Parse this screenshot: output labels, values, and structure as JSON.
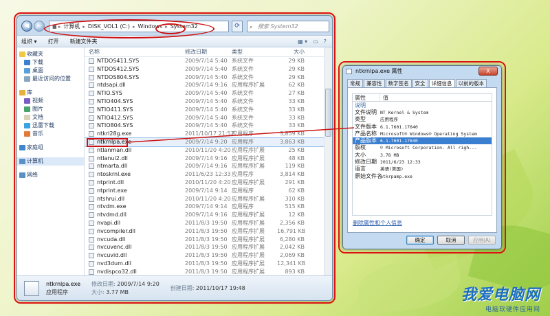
{
  "explorer": {
    "address": [
      "计算机",
      "DISK_VOL1 (C:)",
      "Windows",
      "System32"
    ],
    "search_placeholder": "搜索 System32",
    "toolbar": {
      "organize": "组织 ▾",
      "open": "打开",
      "new_folder": "新建文件夹"
    },
    "sidebar": [
      {
        "label": "收藏夹",
        "head": true,
        "icon": "star-icon"
      },
      {
        "label": "下载",
        "head": false,
        "icon": "download-icon"
      },
      {
        "label": "桌面",
        "head": false,
        "icon": "desktop-icon"
      },
      {
        "label": "最近访问的位置",
        "head": false,
        "icon": "recent-icon"
      },
      {
        "label": "库",
        "head": true,
        "icon": "library-icon"
      },
      {
        "label": "视频",
        "head": false,
        "icon": "video-icon"
      },
      {
        "label": "图片",
        "head": false,
        "icon": "picture-icon"
      },
      {
        "label": "文档",
        "head": false,
        "icon": "document-icon"
      },
      {
        "label": "迅雷下载",
        "head": false,
        "icon": "thunder-icon"
      },
      {
        "label": "音乐",
        "head": false,
        "icon": "music-icon"
      },
      {
        "label": "家庭组",
        "head": true,
        "icon": "homegroup-icon"
      },
      {
        "label": "计算机",
        "head": true,
        "icon": "computer-icon",
        "selected": true
      },
      {
        "label": "网络",
        "head": true,
        "icon": "network-icon"
      }
    ],
    "columns": {
      "name": "名称",
      "date": "修改日期",
      "type": "类型",
      "size": "大小"
    },
    "files": [
      {
        "name": "NTDOS411.SYS",
        "date": "2009/7/14 5:40",
        "type": "系统文件",
        "size": "29 KB"
      },
      {
        "name": "NTDOS412.SYS",
        "date": "2009/7/14 5:40",
        "type": "系统文件",
        "size": "29 KB"
      },
      {
        "name": "NTDOS804.SYS",
        "date": "2009/7/14 5:40",
        "type": "系统文件",
        "size": "29 KB"
      },
      {
        "name": "ntdsapi.dll",
        "date": "2009/7/14 9:16",
        "type": "应用程序扩展",
        "size": "62 KB"
      },
      {
        "name": "NTIO.SYS",
        "date": "2009/7/14 5:40",
        "type": "系统文件",
        "size": "27 KB"
      },
      {
        "name": "NTIO404.SYS",
        "date": "2009/7/14 5:40",
        "type": "系统文件",
        "size": "33 KB"
      },
      {
        "name": "NTIO411.SYS",
        "date": "2009/7/14 5:40",
        "type": "系统文件",
        "size": "33 KB"
      },
      {
        "name": "NTIO412.SYS",
        "date": "2009/7/14 5:40",
        "type": "系统文件",
        "size": "33 KB"
      },
      {
        "name": "NTIO804.SYS",
        "date": "2009/7/14 5:40",
        "type": "系统文件",
        "size": "33 KB"
      },
      {
        "name": "ntkrl28g.exe",
        "date": "2011/10/17 21:52",
        "type": "应用程序",
        "size": "3,859 KB"
      },
      {
        "name": "ntkrnlpa.exe",
        "date": "2009/7/14 9:20",
        "type": "应用程序",
        "size": "3,863 KB",
        "highlight": true
      },
      {
        "name": "ntlanman.dll",
        "date": "2010/11/20 4:20",
        "type": "应用程序扩展",
        "size": "25 KB"
      },
      {
        "name": "ntlanui2.dll",
        "date": "2009/7/14 9:16",
        "type": "应用程序扩展",
        "size": "48 KB"
      },
      {
        "name": "ntmarta.dll",
        "date": "2009/7/14 9:16",
        "type": "应用程序扩展",
        "size": "119 KB"
      },
      {
        "name": "ntoskrnl.exe",
        "date": "2011/6/23 12:33",
        "type": "应用程序",
        "size": "3,814 KB"
      },
      {
        "name": "ntprint.dll",
        "date": "2010/11/20 4:20",
        "type": "应用程序扩展",
        "size": "291 KB"
      },
      {
        "name": "ntprint.exe",
        "date": "2009/7/14 9:14",
        "type": "应用程序",
        "size": "62 KB"
      },
      {
        "name": "ntshrui.dll",
        "date": "2010/11/20 4:20",
        "type": "应用程序扩展",
        "size": "310 KB"
      },
      {
        "name": "ntvdm.exe",
        "date": "2009/7/14 9:14",
        "type": "应用程序",
        "size": "515 KB"
      },
      {
        "name": "ntvdmd.dll",
        "date": "2009/7/14 9:16",
        "type": "应用程序扩展",
        "size": "12 KB"
      },
      {
        "name": "nvapi.dll",
        "date": "2011/8/3 19:50",
        "type": "应用程序扩展",
        "size": "2,356 KB"
      },
      {
        "name": "nvcompiler.dll",
        "date": "2011/8/3 19:50",
        "type": "应用程序扩展",
        "size": "16,791 KB"
      },
      {
        "name": "nvcuda.dll",
        "date": "2011/8/3 19:50",
        "type": "应用程序扩展",
        "size": "6,280 KB"
      },
      {
        "name": "nvcuvenc.dll",
        "date": "2011/8/3 19:50",
        "type": "应用程序扩展",
        "size": "2,042 KB"
      },
      {
        "name": "nvcuvid.dll",
        "date": "2011/8/3 19:50",
        "type": "应用程序扩展",
        "size": "2,069 KB"
      },
      {
        "name": "nvd3dum.dll",
        "date": "2011/8/3 19:50",
        "type": "应用程序扩展",
        "size": "12,341 KB"
      },
      {
        "name": "nvdispco32.dll",
        "date": "2011/8/3 19:50",
        "type": "应用程序扩展",
        "size": "893 KB"
      }
    ],
    "details": {
      "filename": "ntkrnlpa.exe",
      "filetype": "应用程序",
      "modified_label": "修改日期:",
      "modified": "2009/7/14 9:20",
      "size_label": "大小:",
      "size": "3.77 MB",
      "created_label": "创建日期:",
      "created": "2011/10/17 19:48"
    }
  },
  "props": {
    "title": "ntkrnlpa.exe 属性",
    "close": "X",
    "tabs": [
      "常规",
      "兼容性",
      "数字签名",
      "安全",
      "详细信息",
      "以前的版本"
    ],
    "active_tab": 4,
    "col_property": "属性",
    "col_value": "值",
    "section": "说明",
    "rows": [
      {
        "k": "文件说明",
        "v": "NT Kernel & System"
      },
      {
        "k": "类型",
        "v": "应用程序"
      },
      {
        "k": "文件版本",
        "v": "6.1.7601.17640"
      },
      {
        "k": "产品名称",
        "v": "Microsoft® Windows® Operating System"
      },
      {
        "k": "产品版本",
        "v": "6.1.7601.17640",
        "selected": true
      },
      {
        "k": "版权",
        "v": "© Microsoft Corporation. All righ..."
      },
      {
        "k": "大小",
        "v": "3.78 MB"
      },
      {
        "k": "修改日期",
        "v": "2011/6/23 12:33"
      },
      {
        "k": "语言",
        "v": "英语(美国)"
      },
      {
        "k": "原始文件名",
        "v": "ntkrpamp.exe"
      }
    ],
    "link": "删除属性和个人信息",
    "buttons": {
      "ok": "确定",
      "cancel": "取消",
      "apply": "应用(A)"
    }
  },
  "watermark": {
    "big": "我爱电脑网",
    "small": "电脑软硬件应用网"
  },
  "colors": {
    "accent_red": "#cc1212",
    "selection_blue": "#3b7fd0",
    "window_frame": "#c9dcef"
  }
}
